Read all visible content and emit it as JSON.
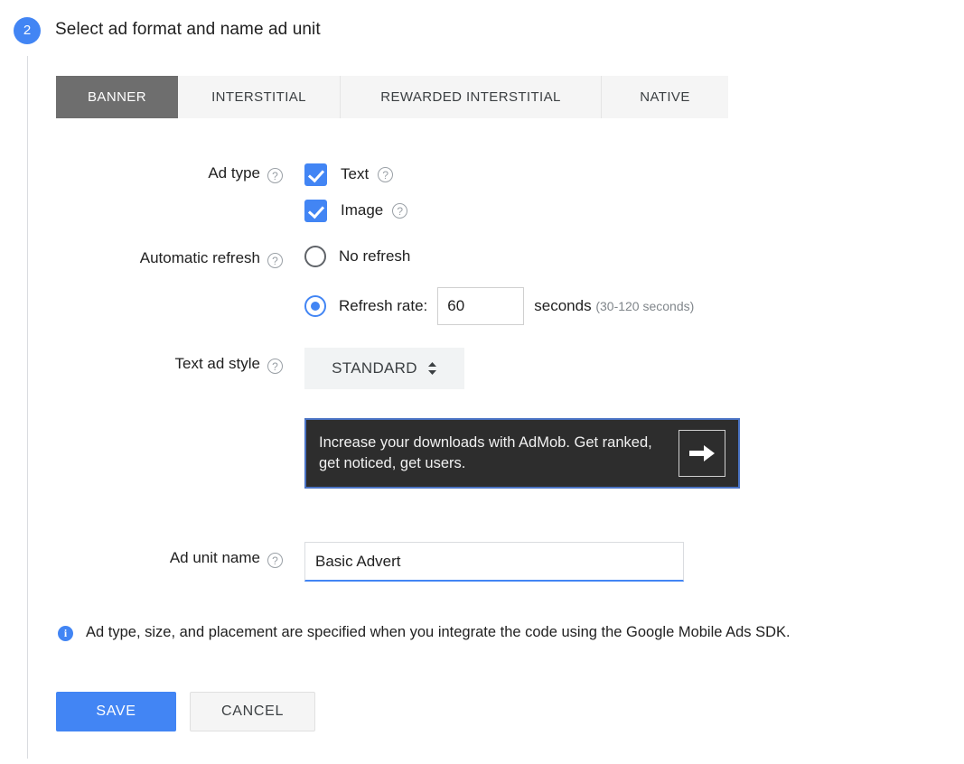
{
  "step": {
    "number": "2",
    "title": "Select ad format and name ad unit"
  },
  "tabs": [
    {
      "label": "BANNER",
      "active": true
    },
    {
      "label": "INTERSTITIAL",
      "active": false
    },
    {
      "label": "REWARDED INTERSTITIAL",
      "active": false
    },
    {
      "label": "NATIVE",
      "active": false
    }
  ],
  "help_glyph": "?",
  "form": {
    "ad_type": {
      "label": "Ad type",
      "options": [
        {
          "label": "Text",
          "checked": true,
          "has_help": true
        },
        {
          "label": "Image",
          "checked": true,
          "has_help": true
        }
      ]
    },
    "automatic_refresh": {
      "label": "Automatic refresh",
      "no_refresh_label": "No refresh",
      "no_refresh_selected": false,
      "refresh_rate_label": "Refresh rate:",
      "refresh_rate_selected": true,
      "refresh_rate_value": "60",
      "refresh_rate_placeholder": "",
      "units_label": "seconds",
      "units_hint": "(30-120 seconds)"
    },
    "text_ad_style": {
      "label": "Text ad style",
      "selected": "STANDARD",
      "options": [
        "STANDARD"
      ]
    },
    "ad_preview": {
      "text": "Increase your downloads with AdMob. Get ranked, get noticed, get users.",
      "arrow_icon": "arrow-right-icon",
      "background_color": "#2d2d2d",
      "border_color": "#4a73c4"
    },
    "ad_unit_name": {
      "label": "Ad unit name",
      "value": "Basic Advert",
      "placeholder": ""
    }
  },
  "info_note": {
    "icon": "info-icon",
    "glyph": "i",
    "text": "Ad type, size, and placement are specified when you integrate the code using the Google Mobile Ads SDK."
  },
  "actions": {
    "save_label": "SAVE",
    "cancel_label": "CANCEL"
  },
  "colors": {
    "accent": "#4285f4",
    "active_tab": "#6e6e6e",
    "tab_background": "#f5f5f5",
    "select_background": "#f1f3f4",
    "help_gray": "#9aa0a6"
  }
}
